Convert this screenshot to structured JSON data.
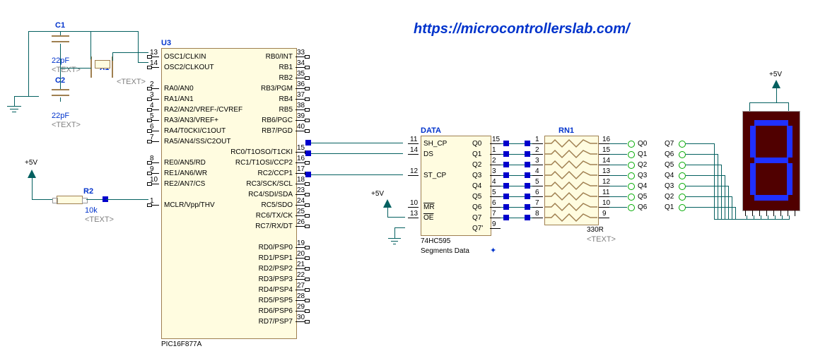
{
  "url": "https://microcontrollerslab.com/",
  "C1": {
    "name": "C1",
    "value": "22pF",
    "txt": "<TEXT>"
  },
  "C2": {
    "name": "C2",
    "value": "22pF",
    "txt": "<TEXT>"
  },
  "X1": {
    "name": "X1",
    "txt": "<TEXT>"
  },
  "R2": {
    "name": "R2",
    "value": "10k",
    "txt": "<TEXT>"
  },
  "U3": {
    "name": "U3",
    "part": "PIC16F877A",
    "leftPins": [
      {
        "no": "13",
        "name": "OSC1/CLKIN"
      },
      {
        "no": "14",
        "name": "OSC2/CLKOUT"
      },
      {
        "no": "",
        "name": ""
      },
      {
        "no": "2",
        "name": "RA0/AN0"
      },
      {
        "no": "3",
        "name": "RA1/AN1"
      },
      {
        "no": "4",
        "name": "RA2/AN2/VREF-/CVREF"
      },
      {
        "no": "5",
        "name": "RA3/AN3/VREF+"
      },
      {
        "no": "6",
        "name": "RA4/T0CKI/C1OUT"
      },
      {
        "no": "7",
        "name": "RA5/AN4/SS/C2OUT"
      },
      {
        "no": "",
        "name": ""
      },
      {
        "no": "8",
        "name": "RE0/AN5/RD"
      },
      {
        "no": "9",
        "name": "RE1/AN6/WR"
      },
      {
        "no": "10",
        "name": "RE2/AN7/CS"
      },
      {
        "no": "",
        "name": ""
      },
      {
        "no": "1",
        "name": "MCLR/Vpp/THV"
      }
    ],
    "rightPins": [
      {
        "no": "33",
        "name": "RB0/INT"
      },
      {
        "no": "34",
        "name": "RB1"
      },
      {
        "no": "35",
        "name": "RB2"
      },
      {
        "no": "36",
        "name": "RB3/PGM"
      },
      {
        "no": "37",
        "name": "RB4"
      },
      {
        "no": "38",
        "name": "RB5"
      },
      {
        "no": "39",
        "name": "RB6/PGC"
      },
      {
        "no": "40",
        "name": "RB7/PGD"
      },
      {
        "no": "",
        "name": ""
      },
      {
        "no": "15",
        "name": "RC0/T1OSO/T1CKI"
      },
      {
        "no": "16",
        "name": "RC1/T1OSI/CCP2"
      },
      {
        "no": "17",
        "name": "RC2/CCP1"
      },
      {
        "no": "18",
        "name": "RC3/SCK/SCL"
      },
      {
        "no": "23",
        "name": "RC4/SDI/SDA"
      },
      {
        "no": "24",
        "name": "RC5/SDO"
      },
      {
        "no": "25",
        "name": "RC6/TX/CK"
      },
      {
        "no": "26",
        "name": "RC7/RX/DT"
      },
      {
        "no": "",
        "name": ""
      },
      {
        "no": "19",
        "name": "RD0/PSP0"
      },
      {
        "no": "20",
        "name": "RD1/PSP1"
      },
      {
        "no": "21",
        "name": "RD2/PSP2"
      },
      {
        "no": "22",
        "name": "RD3/PSP3"
      },
      {
        "no": "27",
        "name": "RD4/PSP4"
      },
      {
        "no": "28",
        "name": "RD5/PSP5"
      },
      {
        "no": "29",
        "name": "RD6/PSP6"
      },
      {
        "no": "30",
        "name": "RD7/PSP7"
      }
    ]
  },
  "DATA": {
    "name": "DATA",
    "part": "74HC595",
    "desc": "Segments Data",
    "leftPins": [
      {
        "no": "11",
        "name": "SH_CP"
      },
      {
        "no": "14",
        "name": "DS"
      },
      {
        "no": "",
        "name": ""
      },
      {
        "no": "12",
        "name": "ST_CP"
      },
      {
        "no": "",
        "name": ""
      },
      {
        "no": "",
        "name": ""
      },
      {
        "no": "10",
        "name": "MR",
        "bar": true
      },
      {
        "no": "13",
        "name": "OE",
        "bar": true
      }
    ],
    "rightPins": [
      {
        "no": "15",
        "name": "Q0"
      },
      {
        "no": "1",
        "name": "Q1"
      },
      {
        "no": "2",
        "name": "Q2"
      },
      {
        "no": "3",
        "name": "Q3"
      },
      {
        "no": "4",
        "name": "Q4"
      },
      {
        "no": "5",
        "name": "Q5"
      },
      {
        "no": "6",
        "name": "Q6"
      },
      {
        "no": "7",
        "name": "Q7"
      },
      {
        "no": "9",
        "name": "Q7'"
      }
    ]
  },
  "RN1": {
    "name": "RN1",
    "value": "330R",
    "txt": "<TEXT>",
    "pinsL": [
      "1",
      "2",
      "3",
      "4",
      "5",
      "6",
      "7",
      "8"
    ],
    "pinsR": [
      "16",
      "15",
      "14",
      "13",
      "12",
      "11",
      "10",
      "9"
    ]
  },
  "netsQ_left": [
    "Q0",
    "Q1",
    "Q2",
    "Q3",
    "Q4",
    "Q5",
    "Q6"
  ],
  "netsQ_right": [
    "Q7",
    "Q6",
    "Q5",
    "Q4",
    "Q3",
    "Q2",
    "Q1"
  ],
  "v5": "+5V"
}
